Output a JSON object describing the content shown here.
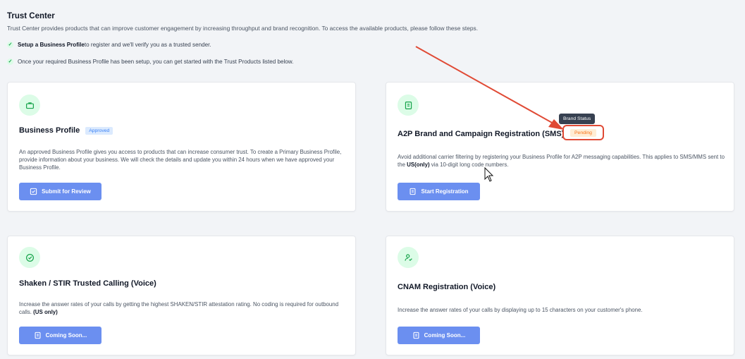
{
  "header": {
    "title": "Trust Center",
    "description": "Trust Center provides products that can improve customer engagement by increasing throughput and brand recognition. To access the available products, please follow these steps.",
    "steps": [
      {
        "bold": "Setup a Business Profile",
        "rest": " to register and we'll verify you as a trusted sender."
      },
      {
        "bold": "",
        "rest": "Once your required Business Profile has been setup, you can get started with the Trust Products listed below."
      }
    ]
  },
  "cards": {
    "business_profile": {
      "icon": "briefcase-icon",
      "title": "Business Profile",
      "badge": "Approved",
      "description": "An approved Business Profile gives you access to products that can increase consumer trust. To create a Primary Business Profile, provide information about your business. We will check the details and update you within 24 hours when we have approved your Business Profile.",
      "button": "Submit for Review"
    },
    "a2p": {
      "icon": "document-icon",
      "title": "A2P Brand and Campaign Registration (SMS)",
      "tooltip": "Brand Status",
      "status": "Pending",
      "description_pre": "Avoid additional carrier filtering by registering your Business Profile for A2P messaging capabilities. This applies to SMS/MMS sent to the ",
      "description_bold": "US(only)",
      "description_post": " via 10-digit long code numbers.",
      "button": "Start Registration"
    },
    "shaken": {
      "icon": "shield-check-icon",
      "title": "Shaken / STIR Trusted Calling (Voice)",
      "description_pre": "Increase the answer rates of your calls by getting the highest SHAKEN/STIR attestation rating. No coding is required for outbound calls. ",
      "description_bold": "(US only)",
      "button": "Coming Soon..."
    },
    "cnam": {
      "icon": "user-check-icon",
      "title": "CNAM Registration (Voice)",
      "description": "Increase the answer rates of your calls by displaying up to 15 characters on your customer's phone.",
      "button": "Coming Soon..."
    }
  },
  "colors": {
    "accent": "#6b8ff0",
    "approved_bg": "#dbeafe",
    "pending_text": "#f97316",
    "annotation_red": "#e04a35",
    "icon_green_bg": "#dcfce7"
  }
}
